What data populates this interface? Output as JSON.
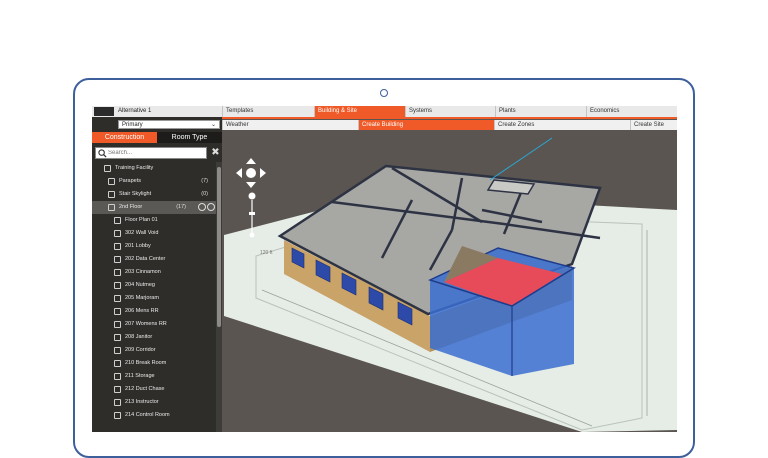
{
  "app": {
    "alternative_name": "Alternative 1",
    "alternative_select": "Primary",
    "main_tabs": [
      {
        "label": "Templates",
        "active": false
      },
      {
        "label": "Building & Site",
        "active": true
      },
      {
        "label": "Systems",
        "active": false
      },
      {
        "label": "Plants",
        "active": false
      },
      {
        "label": "Economics",
        "active": false
      }
    ],
    "sub_tabs": [
      {
        "label": "Weather",
        "active": false
      },
      {
        "label": "Create Building",
        "active": true
      },
      {
        "label": "Create Zones",
        "active": false
      },
      {
        "label": "Create Site",
        "active": false
      }
    ],
    "accent": "#ef5a28"
  },
  "panel": {
    "tabs": [
      {
        "label": "Construction",
        "active": true
      },
      {
        "label": "Room Type",
        "active": false
      }
    ],
    "search_placeholder": "Search...",
    "tree": [
      {
        "label": "Training Facility",
        "count": "",
        "icon": "building-icon",
        "level": 1,
        "selected": false
      },
      {
        "label": "Parapets",
        "count": "(7)",
        "icon": "folder-icon",
        "level": 2,
        "selected": false
      },
      {
        "label": "Stair Skylight",
        "count": "(0)",
        "icon": "layer-icon",
        "level": 2,
        "selected": false
      },
      {
        "label": "2nd Floor",
        "count": "(17)",
        "icon": "layer-icon",
        "level": 2,
        "selected": true
      },
      {
        "label": "Floor Plan 01",
        "count": "",
        "icon": "plan-icon",
        "level": 3,
        "selected": false
      },
      {
        "label": "302 Wall Void",
        "count": "",
        "icon": "room-icon",
        "level": 3,
        "selected": false
      },
      {
        "label": "201 Lobby",
        "count": "",
        "icon": "room-icon",
        "level": 3,
        "selected": false
      },
      {
        "label": "202 Data Center",
        "count": "",
        "icon": "room-icon",
        "level": 3,
        "selected": false
      },
      {
        "label": "203 Cinnamon",
        "count": "",
        "icon": "room-icon",
        "level": 3,
        "selected": false
      },
      {
        "label": "204 Nutmeg",
        "count": "",
        "icon": "room-icon",
        "level": 3,
        "selected": false
      },
      {
        "label": "205 Marjoram",
        "count": "",
        "icon": "room-icon",
        "level": 3,
        "selected": false
      },
      {
        "label": "206 Mens RR",
        "count": "",
        "icon": "room-icon",
        "level": 3,
        "selected": false
      },
      {
        "label": "207 Womens RR",
        "count": "",
        "icon": "room-icon",
        "level": 3,
        "selected": false
      },
      {
        "label": "208 Janitor",
        "count": "",
        "icon": "room-icon",
        "level": 3,
        "selected": false
      },
      {
        "label": "209 Corridor",
        "count": "",
        "icon": "room-icon",
        "level": 3,
        "selected": false
      },
      {
        "label": "210 Break Room",
        "count": "",
        "icon": "room-icon",
        "level": 3,
        "selected": false
      },
      {
        "label": "211 Storage",
        "count": "",
        "icon": "room-icon",
        "level": 3,
        "selected": false
      },
      {
        "label": "212 Duct Chase",
        "count": "",
        "icon": "room-icon",
        "level": 3,
        "selected": false
      },
      {
        "label": "213 Instructor",
        "count": "",
        "icon": "room-icon",
        "level": 3,
        "selected": false
      },
      {
        "label": "214 Control Room",
        "count": "",
        "icon": "room-icon",
        "level": 3,
        "selected": false
      }
    ]
  },
  "viewport": {
    "dimension_label": "120 ft"
  }
}
